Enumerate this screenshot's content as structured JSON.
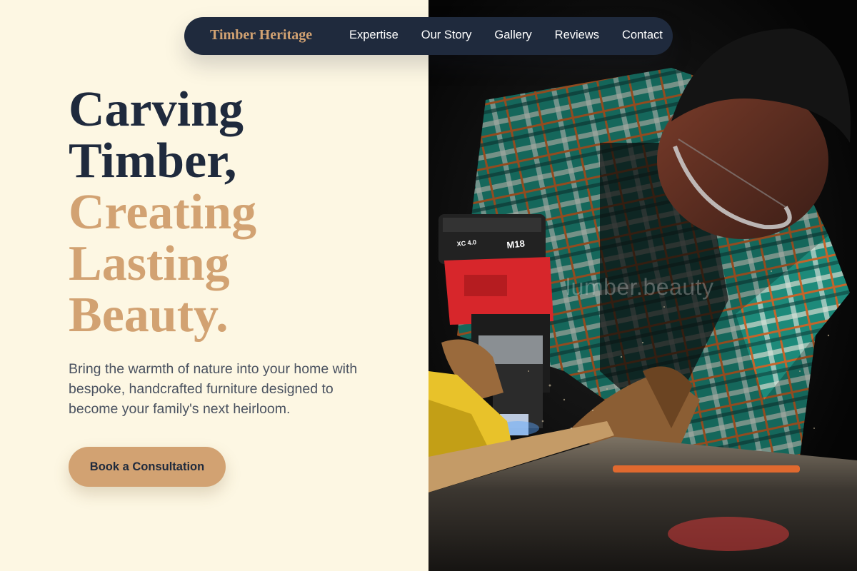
{
  "nav": {
    "brand": "Timber Heritage",
    "links": [
      "Expertise",
      "Our Story",
      "Gallery",
      "Reviews",
      "Contact"
    ]
  },
  "hero": {
    "headline_dark": [
      "Carving",
      "Timber,"
    ],
    "headline_accent": [
      "Creating",
      "Lasting",
      "Beauty."
    ],
    "subtext": "Bring the warmth of nature into your home with bespoke, handcrafted furniture designed to become your family's next heirloom.",
    "cta_label": "Book a Consultation"
  },
  "image": {
    "watermark": "lumber.beauty",
    "tool_label": "M18",
    "tool_sublabel": "XC 4.0"
  },
  "colors": {
    "background": "#fdf7e3",
    "navy": "#1f2a3d",
    "accent_tan": "#d2a272",
    "body_text": "#4a5260"
  }
}
